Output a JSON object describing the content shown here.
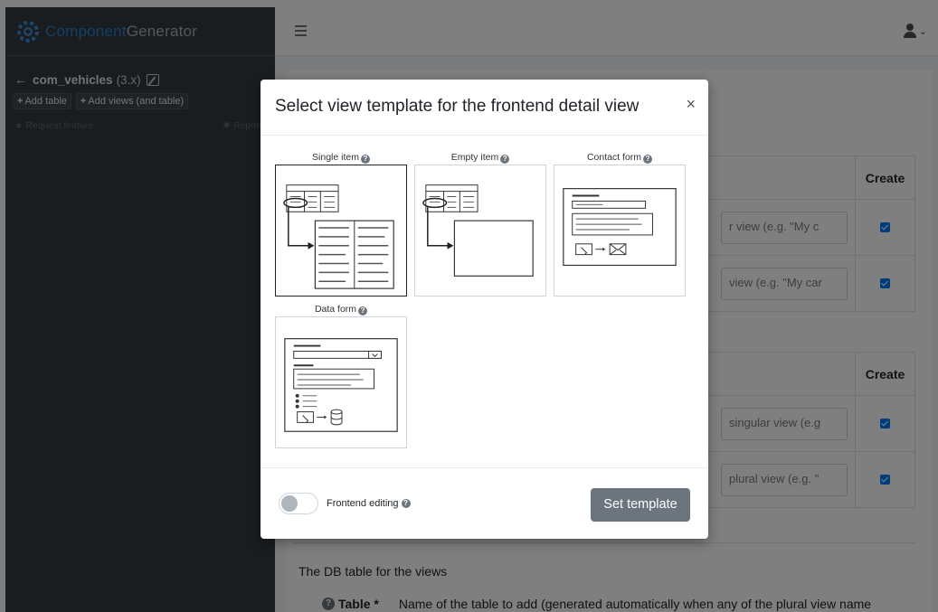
{
  "brand": {
    "part1": "Component",
    "part2": "Generator"
  },
  "component": {
    "name": "com_vehicles",
    "version": "(3.x)"
  },
  "sidebar_buttons": {
    "add_table": "Add table",
    "add_views": "Add views (and table)"
  },
  "sidebar_links": {
    "request_feature": "Request feature",
    "report_bug": "Report bu"
  },
  "main_table": {
    "create_header": "Create",
    "rows_group1": [
      {
        "placeholder": "r view (e.g. \"My c"
      },
      {
        "placeholder": "view (e.g. \"My car"
      }
    ],
    "rows_group2": [
      {
        "placeholder": "singular view (e.g"
      },
      {
        "placeholder": "plural view (e.g. \""
      }
    ]
  },
  "db_section": {
    "heading": "The DB table for the views",
    "table_label": "Table *",
    "table_desc": "Name of the table to add (generated automatically when any of the plural view name"
  },
  "modal": {
    "title": "Select view template for the frontend detail view",
    "close": "×",
    "templates": [
      {
        "label": "Single item",
        "selected": true,
        "icon": "single-item-wireframe-icon"
      },
      {
        "label": "Empty item",
        "selected": false,
        "icon": "empty-item-wireframe-icon"
      },
      {
        "label": "Contact form",
        "selected": false,
        "icon": "contact-form-wireframe-icon"
      },
      {
        "label": "Data form",
        "selected": false,
        "icon": "data-form-wireframe-icon"
      }
    ],
    "frontend_editing_label": "Frontend editing",
    "frontend_editing_enabled": false,
    "set_template_label": "Set template"
  },
  "colors": {
    "sidebar_bg": "#343a40",
    "brand_accent": "#2b7fc8",
    "checkbox": "#007bff",
    "button_secondary": "#6c757d"
  }
}
